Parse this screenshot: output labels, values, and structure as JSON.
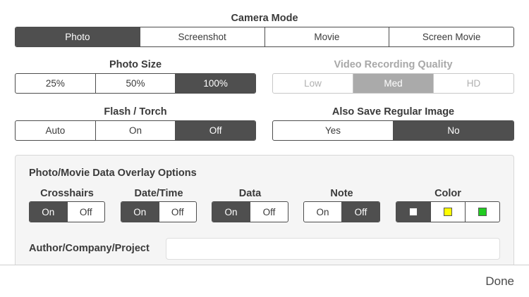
{
  "camera_mode": {
    "label": "Camera Mode",
    "options": [
      "Photo",
      "Screenshot",
      "Movie",
      "Screen Movie"
    ],
    "selected": "Photo"
  },
  "photo_size": {
    "label": "Photo Size",
    "options": [
      "25%",
      "50%",
      "100%"
    ],
    "selected": "100%"
  },
  "video_quality": {
    "label": "Video Recording Quality",
    "options": [
      "Low",
      "Med",
      "HD"
    ],
    "selected": "Med",
    "enabled": false
  },
  "flash_torch": {
    "label": "Flash / Torch",
    "options": [
      "Auto",
      "On",
      "Off"
    ],
    "selected": "Off"
  },
  "save_regular": {
    "label": "Also Save Regular Image",
    "options": [
      "Yes",
      "No"
    ],
    "selected": "No"
  },
  "overlay": {
    "title": "Photo/Movie Data Overlay Options",
    "crosshairs": {
      "label": "Crosshairs",
      "options": [
        "On",
        "Off"
      ],
      "selected": "On"
    },
    "datetime": {
      "label": "Date/Time",
      "options": [
        "On",
        "Off"
      ],
      "selected": "On"
    },
    "data": {
      "label": "Data",
      "options": [
        "On",
        "Off"
      ],
      "selected": "On"
    },
    "note": {
      "label": "Note",
      "options": [
        "On",
        "Off"
      ],
      "selected": "Off"
    },
    "color": {
      "label": "Color",
      "options": [
        "#ffffff",
        "#ffff00",
        "#22cc22"
      ],
      "selected_index": 0
    }
  },
  "author": {
    "label": "Author/Company/Project",
    "value": "",
    "placeholder": ""
  },
  "done_label": "Done"
}
